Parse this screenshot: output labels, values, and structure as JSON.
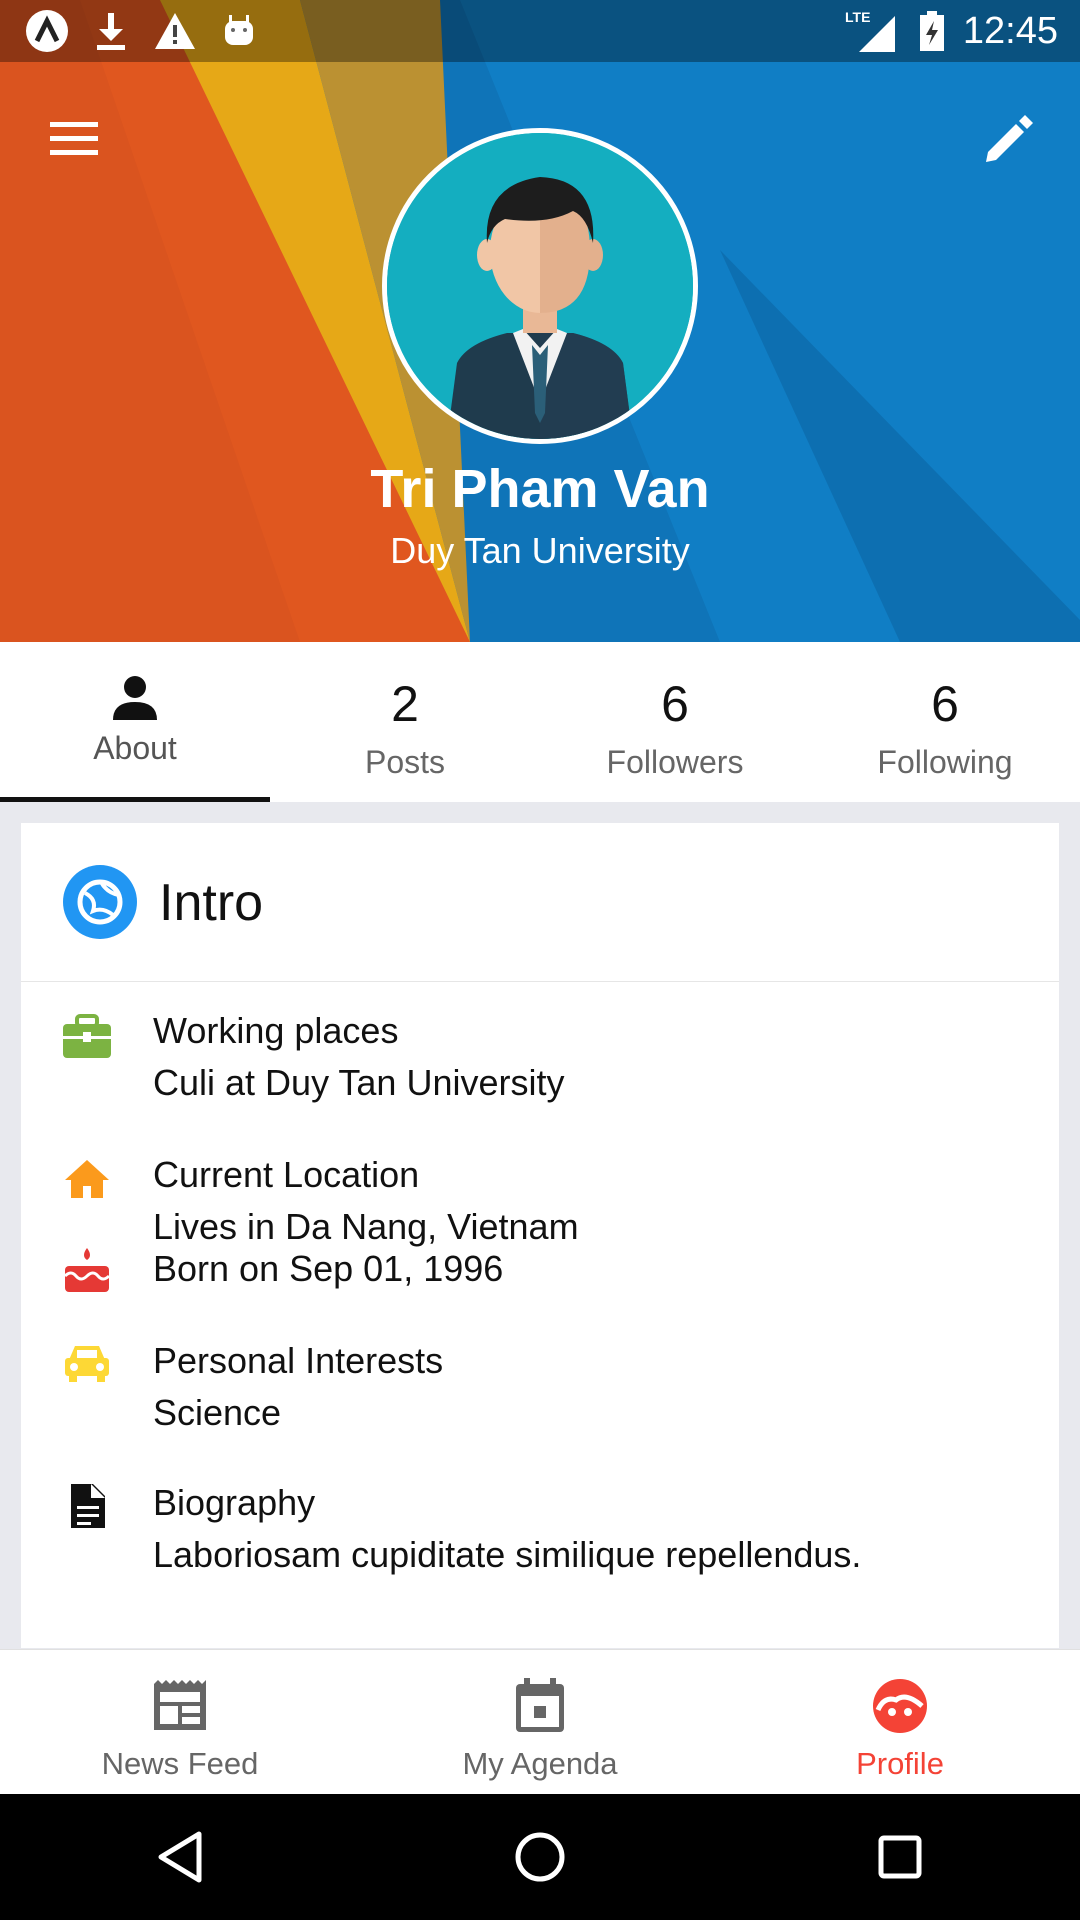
{
  "status_bar": {
    "time": "12:45",
    "network": "LTE",
    "icons": [
      "app-launcher-icon",
      "download-icon",
      "warning-icon",
      "android-icon",
      "lte-signal-icon",
      "battery-charging-icon"
    ]
  },
  "header": {
    "menu_icon": "hamburger-menu-icon",
    "edit_icon": "pencil-edit-icon",
    "name": "Tri Pham Van",
    "subtitle": "Duy Tan University",
    "colors": {
      "orange": "#e0581f",
      "amber": "#e2a113",
      "blue": "#0f7cc1"
    }
  },
  "tabs": [
    {
      "label": "About",
      "icon": "person-icon",
      "active": true
    },
    {
      "count": "2",
      "label": "Posts"
    },
    {
      "count": "6",
      "label": "Followers"
    },
    {
      "count": "6",
      "label": "Following"
    }
  ],
  "intro": {
    "title": "Intro",
    "icon": "globe-icon",
    "items": [
      {
        "icon": "briefcase-icon",
        "color": "#7cb342",
        "title": "Working places",
        "value": "Culi at Duy Tan University"
      },
      {
        "icon": "home-icon",
        "color": "#fb9a1c",
        "title": "Current Location",
        "value": "Lives in Da Nang, Vietnam"
      },
      {
        "icon": "cake-icon",
        "color": "#e53935",
        "title": "Born on Sep 01, 1996",
        "value": ""
      },
      {
        "icon": "car-icon",
        "color": "#fdd835",
        "title": "Personal Interests",
        "value": "Science"
      },
      {
        "icon": "document-icon",
        "color": "#111111",
        "title": "Biography",
        "value": "Laboriosam cupiditate similique repellendus."
      }
    ]
  },
  "bottom_nav": [
    {
      "label": "News Feed",
      "icon": "newspaper-icon",
      "active": false
    },
    {
      "label": "My Agenda",
      "icon": "calendar-icon",
      "active": false
    },
    {
      "label": "Profile",
      "icon": "profile-face-icon",
      "active": true
    }
  ],
  "accent_color": "#f44336",
  "system_nav": [
    "back-icon",
    "home-circle-icon",
    "recents-icon"
  ]
}
